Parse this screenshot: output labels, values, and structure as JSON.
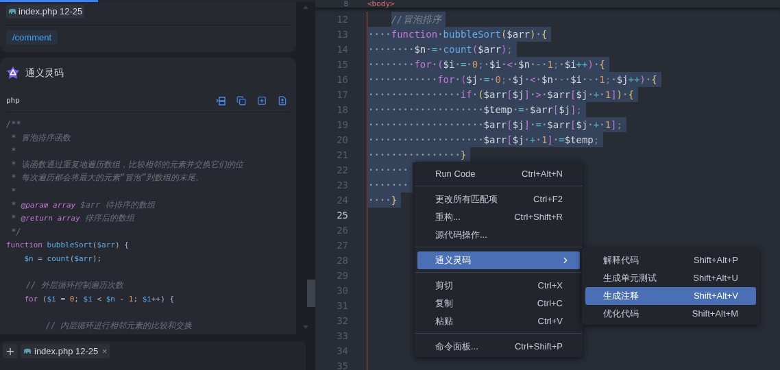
{
  "chat": {
    "progress": {
      "level": 0.31
    },
    "context_card": {
      "file_chip": "index.php 12-25",
      "command": "/comment"
    },
    "answer_card": {
      "assistant_name": "通义灵码",
      "code_block": {
        "language": "php",
        "lines": [
          {
            "kind": "code",
            "tokens": [
              {
                "kind": "comment",
                "text": "/**"
              }
            ]
          },
          {
            "kind": "code",
            "tokens": [
              {
                "kind": "comment",
                "text": " * 冒泡排序函数"
              }
            ]
          },
          {
            "kind": "code",
            "tokens": [
              {
                "kind": "comment",
                "text": " *"
              }
            ]
          },
          {
            "kind": "code",
            "tokens": [
              {
                "kind": "comment",
                "text": " * 该函数通过重复地遍历数组，比较相邻的元素并交换它们的位"
              }
            ]
          },
          {
            "kind": "code",
            "tokens": [
              {
                "kind": "comment",
                "text": " * 每次遍历都会将最大的元素“冒泡”到数组的末尾。"
              }
            ]
          },
          {
            "kind": "code",
            "tokens": [
              {
                "kind": "comment",
                "text": " *"
              }
            ]
          },
          {
            "kind": "code",
            "tokens": [
              {
                "kind": "comment",
                "text": " * "
              },
              {
                "kind": "doctag",
                "text": "@param"
              },
              {
                "kind": "doctype",
                "text": " array"
              },
              {
                "kind": "comment",
                "text": " $arr 待排序的数组"
              }
            ]
          },
          {
            "kind": "code",
            "tokens": [
              {
                "kind": "comment",
                "text": " * "
              },
              {
                "kind": "doctag",
                "text": "@return"
              },
              {
                "kind": "doctype",
                "text": " array"
              },
              {
                "kind": "comment",
                "text": " 排序后的数组"
              }
            ]
          },
          {
            "kind": "code",
            "tokens": [
              {
                "kind": "comment",
                "text": " */"
              }
            ]
          },
          {
            "kind": "code",
            "tokens": [
              {
                "kind": "keyword",
                "text": "function"
              },
              {
                "kind": "function",
                "text": " bubbleSort"
              },
              {
                "kind": "plain",
                "text": "("
              },
              {
                "kind": "name",
                "text": "$arr"
              },
              {
                "kind": "plain",
                "text": ") {"
              }
            ]
          },
          {
            "kind": "code",
            "tokens": [
              {
                "kind": "name",
                "text": "    $n"
              },
              {
                "kind": "plain",
                "text": " ="
              },
              {
                "kind": "function",
                "text": " count"
              },
              {
                "kind": "plain",
                "text": "("
              },
              {
                "kind": "name",
                "text": "$arr"
              },
              {
                "kind": "plain",
                "text": ");"
              }
            ]
          },
          {
            "kind": "blank"
          },
          {
            "kind": "code",
            "tokens": [
              {
                "kind": "comment",
                "text": "    // 外层循环控制遍历次数"
              }
            ]
          },
          {
            "kind": "code",
            "tokens": [
              {
                "kind": "keyword",
                "text": "    for"
              },
              {
                "kind": "plain",
                "text": " ("
              },
              {
                "kind": "name",
                "text": "$i"
              },
              {
                "kind": "plain",
                "text": " ="
              },
              {
                "kind": "number",
                "text": " 0"
              },
              {
                "kind": "plain",
                "text": ";"
              },
              {
                "kind": "name",
                "text": " $i"
              },
              {
                "kind": "plain",
                "text": " <"
              },
              {
                "kind": "name",
                "text": " $n"
              },
              {
                "kind": "plain",
                "text": " -"
              },
              {
                "kind": "number",
                "text": " 1"
              },
              {
                "kind": "plain",
                "text": ";"
              },
              {
                "kind": "name",
                "text": " $i"
              },
              {
                "kind": "plain",
                "text": "++) {"
              }
            ]
          },
          {
            "kind": "blank"
          },
          {
            "kind": "code",
            "tokens": [
              {
                "kind": "comment",
                "text": "        // 内层循环进行相邻元素的比较和交换"
              }
            ]
          }
        ]
      }
    },
    "input_bar": {
      "context_tab": {
        "name": "index.php 12-25",
        "close": "×"
      }
    }
  },
  "editor": {
    "sticky_line": {
      "number": "8",
      "text": "<body>"
    },
    "lines": [
      {
        "number": "12",
        "selected": true,
        "current": false,
        "indented": true,
        "tokens": [
          {
            "kind": "comment",
            "text": "//冒泡排序"
          }
        ]
      },
      {
        "number": "13",
        "selected": true,
        "current": false,
        "tokens": [
          {
            "kind": "ws",
            "text": "····"
          },
          {
            "kind": "keyword",
            "text": "function"
          },
          {
            "kind": "ws",
            "text": "·"
          },
          {
            "kind": "function",
            "text": "bubbleSort"
          },
          {
            "kind": "paren",
            "text": "("
          },
          {
            "kind": "var",
            "text": "$arr"
          },
          {
            "kind": "paren",
            "text": ")"
          },
          {
            "kind": "ws",
            "text": "·"
          },
          {
            "kind": "paren",
            "text": "{"
          }
        ]
      },
      {
        "number": "14",
        "selected": true,
        "current": false,
        "tokens": [
          {
            "kind": "ws",
            "text": "········"
          },
          {
            "kind": "var",
            "text": "$n"
          },
          {
            "kind": "ws",
            "text": "·"
          },
          {
            "kind": "op",
            "text": "="
          },
          {
            "kind": "ws",
            "text": "·"
          },
          {
            "kind": "function",
            "text": "count"
          },
          {
            "kind": "bracket",
            "text": "("
          },
          {
            "kind": "var",
            "text": "$arr"
          },
          {
            "kind": "bracket",
            "text": ")"
          },
          {
            "kind": "punct",
            "text": ";"
          }
        ]
      },
      {
        "number": "15",
        "selected": true,
        "current": false,
        "tokens": [
          {
            "kind": "ws",
            "text": "········"
          },
          {
            "kind": "keyword",
            "text": "for"
          },
          {
            "kind": "ws",
            "text": "·"
          },
          {
            "kind": "bracket",
            "text": "("
          },
          {
            "kind": "var",
            "text": "$i"
          },
          {
            "kind": "ws",
            "text": "·"
          },
          {
            "kind": "op",
            "text": "="
          },
          {
            "kind": "ws",
            "text": "·"
          },
          {
            "kind": "number",
            "text": "0"
          },
          {
            "kind": "punct",
            "text": ";"
          },
          {
            "kind": "ws",
            "text": "·"
          },
          {
            "kind": "var",
            "text": "$i"
          },
          {
            "kind": "ws",
            "text": "·"
          },
          {
            "kind": "keyword",
            "text": "<"
          },
          {
            "kind": "ws",
            "text": "·"
          },
          {
            "kind": "var",
            "text": "$n"
          },
          {
            "kind": "ws",
            "text": "·"
          },
          {
            "kind": "op",
            "text": "-"
          },
          {
            "kind": "ws",
            "text": "·"
          },
          {
            "kind": "number",
            "text": "1"
          },
          {
            "kind": "punct",
            "text": ";"
          },
          {
            "kind": "ws",
            "text": "·"
          },
          {
            "kind": "var",
            "text": "$i"
          },
          {
            "kind": "op",
            "text": "++"
          },
          {
            "kind": "bracket",
            "text": ")"
          },
          {
            "kind": "ws",
            "text": "·"
          },
          {
            "kind": "paren",
            "text": "{"
          }
        ]
      },
      {
        "number": "16",
        "selected": true,
        "current": false,
        "tokens": [
          {
            "kind": "ws",
            "text": "············"
          },
          {
            "kind": "keyword",
            "text": "for"
          },
          {
            "kind": "ws",
            "text": "·"
          },
          {
            "kind": "bracket",
            "text": "("
          },
          {
            "kind": "var",
            "text": "$j"
          },
          {
            "kind": "ws",
            "text": "·"
          },
          {
            "kind": "op",
            "text": "="
          },
          {
            "kind": "ws",
            "text": "·"
          },
          {
            "kind": "number",
            "text": "0"
          },
          {
            "kind": "punct",
            "text": ";"
          },
          {
            "kind": "ws",
            "text": "·"
          },
          {
            "kind": "var",
            "text": "$j"
          },
          {
            "kind": "ws",
            "text": "·"
          },
          {
            "kind": "keyword",
            "text": "<"
          },
          {
            "kind": "ws",
            "text": "·"
          },
          {
            "kind": "var",
            "text": "$n"
          },
          {
            "kind": "ws",
            "text": "·"
          },
          {
            "kind": "op",
            "text": "-"
          },
          {
            "kind": "ws",
            "text": "·"
          },
          {
            "kind": "var",
            "text": "$i"
          },
          {
            "kind": "ws",
            "text": "·"
          },
          {
            "kind": "op",
            "text": "-"
          },
          {
            "kind": "ws",
            "text": "·"
          },
          {
            "kind": "number",
            "text": "1"
          },
          {
            "kind": "punct",
            "text": ";"
          },
          {
            "kind": "ws",
            "text": "·"
          },
          {
            "kind": "var",
            "text": "$j"
          },
          {
            "kind": "op",
            "text": "++"
          },
          {
            "kind": "bracket",
            "text": ")"
          },
          {
            "kind": "ws",
            "text": "·"
          },
          {
            "kind": "paren",
            "text": "{"
          }
        ]
      },
      {
        "number": "17",
        "selected": true,
        "current": false,
        "tokens": [
          {
            "kind": "ws",
            "text": "················"
          },
          {
            "kind": "keyword",
            "text": "if"
          },
          {
            "kind": "ws",
            "text": "·"
          },
          {
            "kind": "paren",
            "text": "("
          },
          {
            "kind": "var",
            "text": "$arr"
          },
          {
            "kind": "bracket",
            "text": "["
          },
          {
            "kind": "var",
            "text": "$j"
          },
          {
            "kind": "bracket",
            "text": "]"
          },
          {
            "kind": "ws",
            "text": "·"
          },
          {
            "kind": "keyword",
            "text": ">"
          },
          {
            "kind": "ws",
            "text": "·"
          },
          {
            "kind": "var",
            "text": "$arr"
          },
          {
            "kind": "bracket",
            "text": "["
          },
          {
            "kind": "var",
            "text": "$j"
          },
          {
            "kind": "ws",
            "text": "·"
          },
          {
            "kind": "op",
            "text": "+"
          },
          {
            "kind": "ws",
            "text": "·"
          },
          {
            "kind": "number",
            "text": "1"
          },
          {
            "kind": "bracket",
            "text": "]"
          },
          {
            "kind": "paren",
            "text": ")"
          },
          {
            "kind": "ws",
            "text": "·"
          },
          {
            "kind": "paren",
            "text": "{"
          }
        ]
      },
      {
        "number": "18",
        "selected": true,
        "current": false,
        "tokens": [
          {
            "kind": "ws",
            "text": "····················"
          },
          {
            "kind": "var",
            "text": "$temp"
          },
          {
            "kind": "ws",
            "text": "·"
          },
          {
            "kind": "op",
            "text": "="
          },
          {
            "kind": "ws",
            "text": "·"
          },
          {
            "kind": "var",
            "text": "$arr"
          },
          {
            "kind": "bracket",
            "text": "["
          },
          {
            "kind": "var",
            "text": "$j"
          },
          {
            "kind": "bracket",
            "text": "]"
          },
          {
            "kind": "punct",
            "text": ";"
          }
        ]
      },
      {
        "number": "19",
        "selected": true,
        "current": false,
        "tokens": [
          {
            "kind": "ws",
            "text": "····················"
          },
          {
            "kind": "var",
            "text": "$arr"
          },
          {
            "kind": "bracket",
            "text": "["
          },
          {
            "kind": "var",
            "text": "$j"
          },
          {
            "kind": "bracket",
            "text": "]"
          },
          {
            "kind": "ws",
            "text": "·"
          },
          {
            "kind": "op",
            "text": "="
          },
          {
            "kind": "ws",
            "text": "·"
          },
          {
            "kind": "var",
            "text": "$arr"
          },
          {
            "kind": "bracket",
            "text": "["
          },
          {
            "kind": "var",
            "text": "$j"
          },
          {
            "kind": "ws",
            "text": "·"
          },
          {
            "kind": "op",
            "text": "+"
          },
          {
            "kind": "ws",
            "text": "·"
          },
          {
            "kind": "number",
            "text": "1"
          },
          {
            "kind": "bracket",
            "text": "]"
          },
          {
            "kind": "punct",
            "text": ";"
          }
        ]
      },
      {
        "number": "20",
        "selected": true,
        "current": false,
        "tokens": [
          {
            "kind": "ws",
            "text": "····················"
          },
          {
            "kind": "var",
            "text": "$arr"
          },
          {
            "kind": "bracket",
            "text": "["
          },
          {
            "kind": "var",
            "text": "$j"
          },
          {
            "kind": "ws",
            "text": "·"
          },
          {
            "kind": "op",
            "text": "+"
          },
          {
            "kind": "ws",
            "text": "·"
          },
          {
            "kind": "number",
            "text": "1"
          },
          {
            "kind": "bracket",
            "text": "]"
          },
          {
            "kind": "ws",
            "text": "·"
          },
          {
            "kind": "op",
            "text": "="
          },
          {
            "kind": "var",
            "text": "$temp"
          },
          {
            "kind": "punct",
            "text": ";"
          }
        ]
      },
      {
        "number": "21",
        "selected": true,
        "current": false,
        "tokens": [
          {
            "kind": "ws",
            "text": "················"
          },
          {
            "kind": "paren",
            "text": "}"
          }
        ]
      },
      {
        "number": "22",
        "selected": true,
        "current": false,
        "tokens": [
          {
            "kind": "ws",
            "text": "·······"
          }
        ]
      },
      {
        "number": "23",
        "selected": true,
        "current": false,
        "tokens": [
          {
            "kind": "ws",
            "text": "·······"
          }
        ]
      },
      {
        "number": "24",
        "selected": true,
        "current": false,
        "tokens": [
          {
            "kind": "ws",
            "text": "····"
          },
          {
            "kind": "paren",
            "text": "}"
          }
        ]
      },
      {
        "number": "25",
        "selected": false,
        "current": true
      },
      {
        "number": "26",
        "selected": false,
        "current": false
      },
      {
        "number": "27",
        "selected": false,
        "current": false
      },
      {
        "number": "28",
        "selected": false,
        "current": false
      },
      {
        "number": "29",
        "selected": false,
        "current": false
      },
      {
        "number": "30",
        "selected": false,
        "current": false
      },
      {
        "number": "31",
        "selected": false,
        "current": false
      },
      {
        "number": "32",
        "selected": false,
        "current": false
      },
      {
        "number": "33",
        "selected": false,
        "current": false
      },
      {
        "number": "34",
        "selected": false,
        "current": false
      },
      {
        "number": "35",
        "selected": false,
        "current": false
      }
    ]
  },
  "context_menu": {
    "groups": [
      [
        {
          "label": "Run Code",
          "shortcut": "Ctrl+Alt+N",
          "selected": false,
          "submenu": false
        }
      ],
      [
        {
          "label": "更改所有匹配项",
          "shortcut": "Ctrl+F2",
          "selected": false,
          "submenu": false
        },
        {
          "label": "重构...",
          "shortcut": "Ctrl+Shift+R",
          "selected": false,
          "submenu": false
        },
        {
          "label": "源代码操作...",
          "selected": false,
          "submenu": false
        }
      ],
      [
        {
          "label": "通义灵码",
          "selected": true,
          "submenu": true
        }
      ],
      [
        {
          "label": "剪切",
          "shortcut": "Ctrl+X",
          "selected": false,
          "submenu": false
        },
        {
          "label": "复制",
          "shortcut": "Ctrl+C",
          "selected": false,
          "submenu": false
        },
        {
          "label": "粘贴",
          "shortcut": "Ctrl+V",
          "selected": false,
          "submenu": false
        }
      ],
      [
        {
          "label": "命令面板...",
          "shortcut": "Ctrl+Shift+P",
          "selected": false,
          "submenu": false
        }
      ]
    ]
  },
  "submenu": {
    "items": [
      {
        "label": "解释代码",
        "shortcut": "Shift+Alt+P",
        "selected": false
      },
      {
        "label": "生成单元测试",
        "shortcut": "Shift+Alt+U",
        "selected": false
      },
      {
        "label": "生成注释",
        "shortcut": "Shift+Alt+V",
        "selected": true
      },
      {
        "label": "优化代码",
        "shortcut": "Shift+Alt+M",
        "selected": false
      }
    ]
  }
}
